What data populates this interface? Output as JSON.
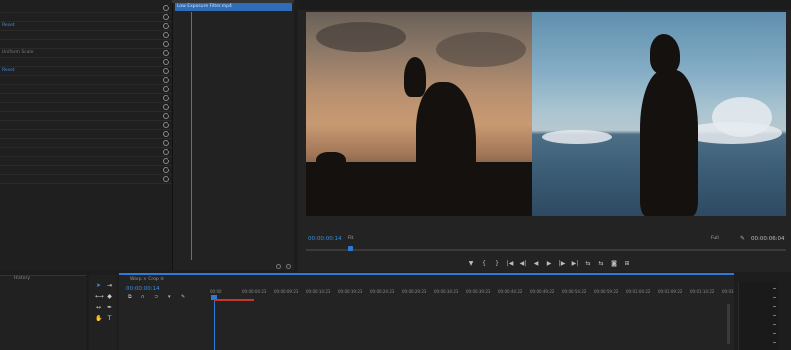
{
  "effect_controls": {
    "rows": [
      {
        "label": "",
        "style": "plain"
      },
      {
        "label": "",
        "style": "plain"
      },
      {
        "label": "Reset",
        "style": "blue"
      },
      {
        "label": "",
        "style": "plain"
      },
      {
        "label": "",
        "style": "plain"
      },
      {
        "label": "Uniform Scale",
        "style": "plain"
      },
      {
        "label": "",
        "style": "plain"
      },
      {
        "label": "Reset",
        "style": "blue"
      },
      {
        "label": "",
        "style": "plain"
      },
      {
        "label": "",
        "style": "plain"
      },
      {
        "label": "",
        "style": "plain"
      },
      {
        "label": "",
        "style": "plain"
      },
      {
        "label": "",
        "style": "plain"
      },
      {
        "label": "",
        "style": "plain"
      },
      {
        "label": "",
        "style": "plain"
      },
      {
        "label": "",
        "style": "plain"
      },
      {
        "label": "",
        "style": "plain"
      },
      {
        "label": "",
        "style": "plain"
      },
      {
        "label": "",
        "style": "plain"
      },
      {
        "label": "",
        "style": "plain"
      }
    ],
    "clip_name": "Low Exposure Filter.mp4"
  },
  "program_monitor": {
    "timecode_current": "00:00:00:14",
    "zoom": "Fit",
    "resolution": "Full",
    "timecode_duration": "00:00:06:04",
    "transport": [
      "▼",
      "{",
      "}",
      "|◀",
      "◀|",
      "◀",
      "▶",
      "|▶",
      "▶|",
      "⇆",
      "⇆",
      "◙",
      "⊞"
    ]
  },
  "history": {
    "title": "History"
  },
  "timeline": {
    "tabs": "Warp  ×  Crop  ≡",
    "timecode": "00:00:00:14",
    "ruler_ticks": [
      "00:00",
      "00:00:04:23",
      "00:00:09:23",
      "00:00:14:23",
      "00:00:19:23",
      "00:00:24:23",
      "00:00:29:23",
      "00:00:34:23",
      "00:00:39:23",
      "00:00:44:22",
      "00:00:49:22",
      "00:00:54:22",
      "00:00:59:22",
      "00:01:04:22",
      "00:01:09:22",
      "00:01:14:22",
      "00:03"
    ]
  },
  "colors": {
    "accent": "#2d7bd8",
    "work_area": "#c0392b"
  }
}
